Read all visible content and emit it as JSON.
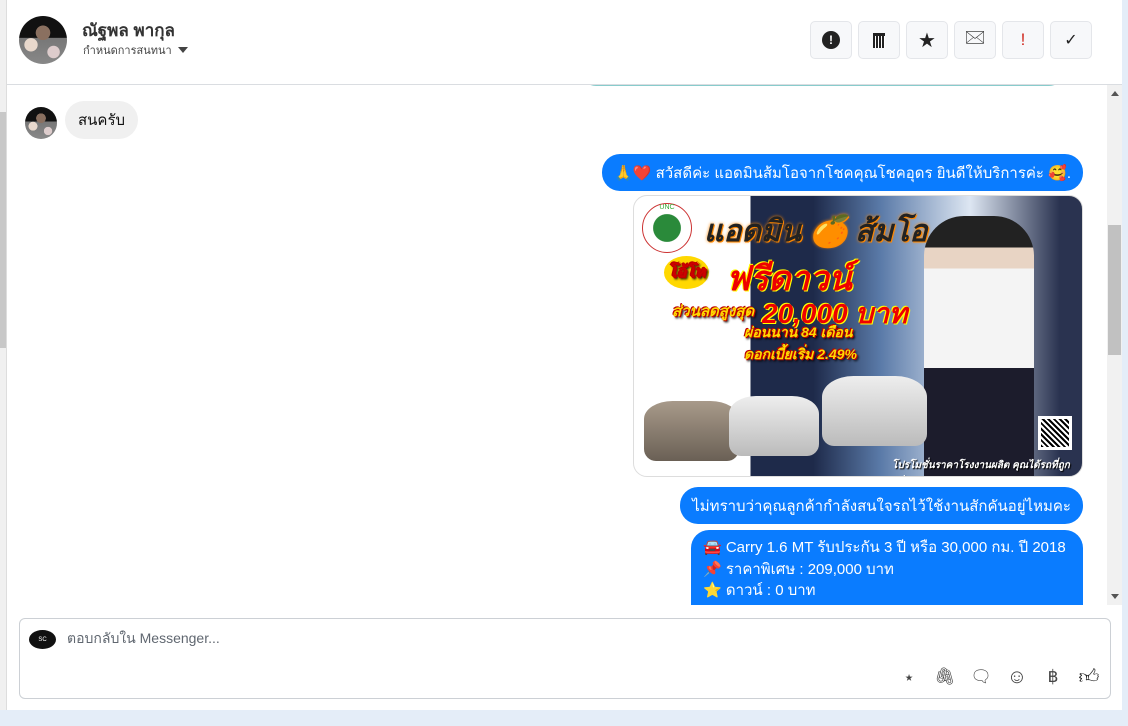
{
  "header": {
    "name": "ณัฐพล พากุล",
    "subtitle": "กำหนดการสนทนา",
    "actions": [
      {
        "name": "spam",
        "glyph": "❗"
      },
      {
        "name": "delete",
        "glyph": "🗑"
      },
      {
        "name": "star",
        "glyph": "★"
      },
      {
        "name": "mark-unread",
        "glyph": "✉"
      },
      {
        "name": "important",
        "glyph": "!"
      },
      {
        "name": "done",
        "glyph": "✓"
      }
    ]
  },
  "messages": {
    "incoming": "สนครับ",
    "greeting": "🙏❤️ สวัสดีค่ะ แอดมินส้มโอจากโชคคุณโชคอุดร ยินดีให้บริการค่ะ 🥰.",
    "poster": {
      "logo": "UNC",
      "title": "แอดมิน 🍊 ส้มโอ",
      "badge": "โอ้โห",
      "headline": "ฟรีดาวน์",
      "discount_label": "ส่วนลดสูงสุด",
      "discount": "20,000 บาท",
      "installment": "ผ่อนนาน 84 เดือน",
      "interest": "ดอกเบี้ยเริ่ม 2.49%",
      "footer": "โปรโมชั่นราคาโรงงานผลิต คุณได้รถที่ถูกกว่า"
    },
    "question": "ไม่ทราบว่าคุณลูกค้ากำลังสนใจรถไว้ใช้งานสักคันอยู่ไหมคะ",
    "offer_lines": [
      "🚘 Carry 1.6 MT รับประกัน 3 ปี หรือ 30,000 กม. ปี 2018",
      "📌 ราคาพิเศษ : 209,000 บาท",
      "⭐ ดาวน์ : 0 บาท"
    ]
  },
  "composer": {
    "placeholder": "ตอบกลับใน Messenger...",
    "avatar_text": "SC",
    "tools": [
      {
        "name": "saved-reply",
        "glyph": "💬"
      },
      {
        "name": "attach",
        "glyph": "📎"
      },
      {
        "name": "quick-reply",
        "glyph": "🗨"
      },
      {
        "name": "emoji",
        "glyph": "☺"
      },
      {
        "name": "payment",
        "glyph": "฿"
      },
      {
        "name": "like",
        "glyph": "👍"
      }
    ]
  },
  "colors": {
    "accent": "#0a7cff",
    "incoming_bg": "#f0f0f0"
  }
}
